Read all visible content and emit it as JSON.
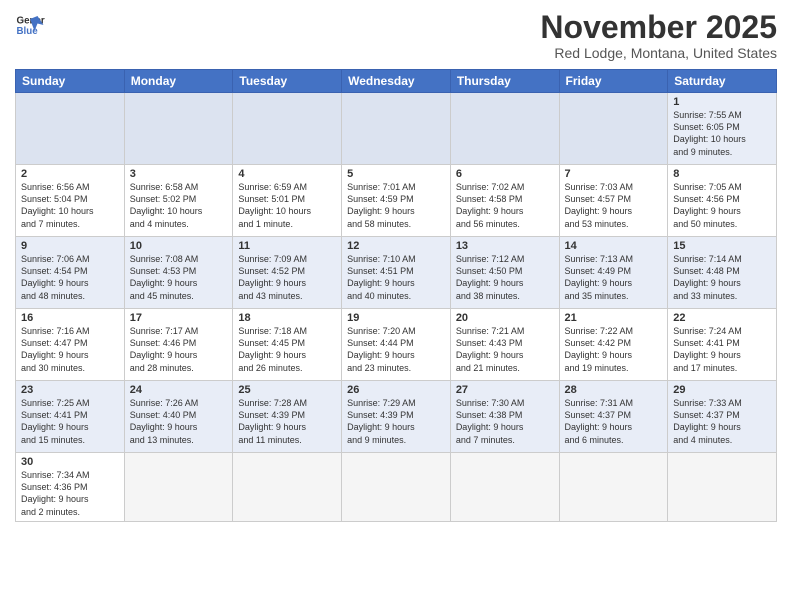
{
  "header": {
    "logo_line1": "General",
    "logo_line2": "Blue",
    "month_title": "November 2025",
    "location": "Red Lodge, Montana, United States"
  },
  "weekdays": [
    "Sunday",
    "Monday",
    "Tuesday",
    "Wednesday",
    "Thursday",
    "Friday",
    "Saturday"
  ],
  "weeks": [
    [
      {
        "day": "",
        "info": ""
      },
      {
        "day": "",
        "info": ""
      },
      {
        "day": "",
        "info": ""
      },
      {
        "day": "",
        "info": ""
      },
      {
        "day": "",
        "info": ""
      },
      {
        "day": "",
        "info": ""
      },
      {
        "day": "1",
        "info": "Sunrise: 7:55 AM\nSunset: 6:05 PM\nDaylight: 10 hours\nand 9 minutes."
      }
    ],
    [
      {
        "day": "2",
        "info": "Sunrise: 6:56 AM\nSunset: 5:04 PM\nDaylight: 10 hours\nand 7 minutes."
      },
      {
        "day": "3",
        "info": "Sunrise: 6:58 AM\nSunset: 5:02 PM\nDaylight: 10 hours\nand 4 minutes."
      },
      {
        "day": "4",
        "info": "Sunrise: 6:59 AM\nSunset: 5:01 PM\nDaylight: 10 hours\nand 1 minute."
      },
      {
        "day": "5",
        "info": "Sunrise: 7:01 AM\nSunset: 4:59 PM\nDaylight: 9 hours\nand 58 minutes."
      },
      {
        "day": "6",
        "info": "Sunrise: 7:02 AM\nSunset: 4:58 PM\nDaylight: 9 hours\nand 56 minutes."
      },
      {
        "day": "7",
        "info": "Sunrise: 7:03 AM\nSunset: 4:57 PM\nDaylight: 9 hours\nand 53 minutes."
      },
      {
        "day": "8",
        "info": "Sunrise: 7:05 AM\nSunset: 4:56 PM\nDaylight: 9 hours\nand 50 minutes."
      }
    ],
    [
      {
        "day": "9",
        "info": "Sunrise: 7:06 AM\nSunset: 4:54 PM\nDaylight: 9 hours\nand 48 minutes."
      },
      {
        "day": "10",
        "info": "Sunrise: 7:08 AM\nSunset: 4:53 PM\nDaylight: 9 hours\nand 45 minutes."
      },
      {
        "day": "11",
        "info": "Sunrise: 7:09 AM\nSunset: 4:52 PM\nDaylight: 9 hours\nand 43 minutes."
      },
      {
        "day": "12",
        "info": "Sunrise: 7:10 AM\nSunset: 4:51 PM\nDaylight: 9 hours\nand 40 minutes."
      },
      {
        "day": "13",
        "info": "Sunrise: 7:12 AM\nSunset: 4:50 PM\nDaylight: 9 hours\nand 38 minutes."
      },
      {
        "day": "14",
        "info": "Sunrise: 7:13 AM\nSunset: 4:49 PM\nDaylight: 9 hours\nand 35 minutes."
      },
      {
        "day": "15",
        "info": "Sunrise: 7:14 AM\nSunset: 4:48 PM\nDaylight: 9 hours\nand 33 minutes."
      }
    ],
    [
      {
        "day": "16",
        "info": "Sunrise: 7:16 AM\nSunset: 4:47 PM\nDaylight: 9 hours\nand 30 minutes."
      },
      {
        "day": "17",
        "info": "Sunrise: 7:17 AM\nSunset: 4:46 PM\nDaylight: 9 hours\nand 28 minutes."
      },
      {
        "day": "18",
        "info": "Sunrise: 7:18 AM\nSunset: 4:45 PM\nDaylight: 9 hours\nand 26 minutes."
      },
      {
        "day": "19",
        "info": "Sunrise: 7:20 AM\nSunset: 4:44 PM\nDaylight: 9 hours\nand 23 minutes."
      },
      {
        "day": "20",
        "info": "Sunrise: 7:21 AM\nSunset: 4:43 PM\nDaylight: 9 hours\nand 21 minutes."
      },
      {
        "day": "21",
        "info": "Sunrise: 7:22 AM\nSunset: 4:42 PM\nDaylight: 9 hours\nand 19 minutes."
      },
      {
        "day": "22",
        "info": "Sunrise: 7:24 AM\nSunset: 4:41 PM\nDaylight: 9 hours\nand 17 minutes."
      }
    ],
    [
      {
        "day": "23",
        "info": "Sunrise: 7:25 AM\nSunset: 4:41 PM\nDaylight: 9 hours\nand 15 minutes."
      },
      {
        "day": "24",
        "info": "Sunrise: 7:26 AM\nSunset: 4:40 PM\nDaylight: 9 hours\nand 13 minutes."
      },
      {
        "day": "25",
        "info": "Sunrise: 7:28 AM\nSunset: 4:39 PM\nDaylight: 9 hours\nand 11 minutes."
      },
      {
        "day": "26",
        "info": "Sunrise: 7:29 AM\nSunset: 4:39 PM\nDaylight: 9 hours\nand 9 minutes."
      },
      {
        "day": "27",
        "info": "Sunrise: 7:30 AM\nSunset: 4:38 PM\nDaylight: 9 hours\nand 7 minutes."
      },
      {
        "day": "28",
        "info": "Sunrise: 7:31 AM\nSunset: 4:37 PM\nDaylight: 9 hours\nand 6 minutes."
      },
      {
        "day": "29",
        "info": "Sunrise: 7:33 AM\nSunset: 4:37 PM\nDaylight: 9 hours\nand 4 minutes."
      }
    ],
    [
      {
        "day": "30",
        "info": "Sunrise: 7:34 AM\nSunset: 4:36 PM\nDaylight: 9 hours\nand 2 minutes."
      },
      {
        "day": "",
        "info": ""
      },
      {
        "day": "",
        "info": ""
      },
      {
        "day": "",
        "info": ""
      },
      {
        "day": "",
        "info": ""
      },
      {
        "day": "",
        "info": ""
      },
      {
        "day": "",
        "info": ""
      }
    ]
  ]
}
